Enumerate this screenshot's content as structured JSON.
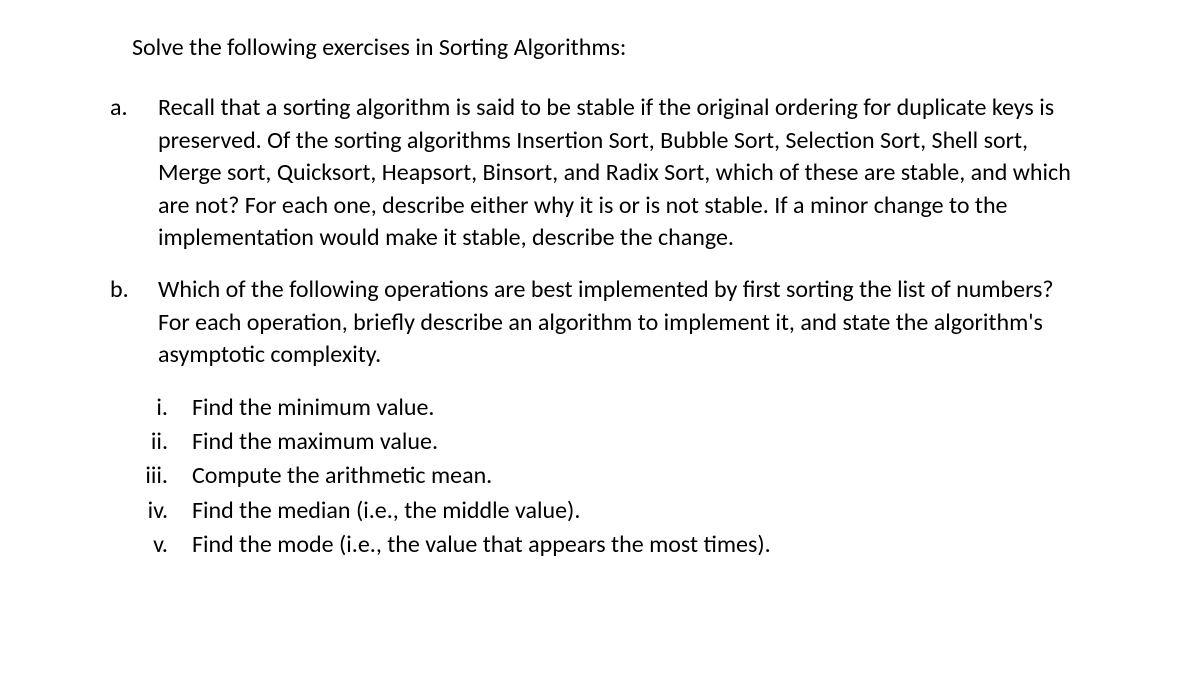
{
  "title": "Solve the following exercises in Sorting Algorithms:",
  "itemA": {
    "letter": "a.",
    "text": "Recall that a sorting algorithm is said to be stable if the original ordering for duplicate keys is preserved. Of the sorting algorithms Insertion Sort, Bubble Sort, Selection Sort, Shell sort, Merge sort, Quicksort, Heapsort, Binsort, and Radix Sort, which of these are stable, and which are not? For each one, describe either why it is or is not stable. If a minor change to the implementation would make it stable, describe the change."
  },
  "itemB": {
    "letter": "b.",
    "text": "Which of the following operations are best implemented by first sorting the list of numbers? For each operation, briefly describe an algorithm to implement it, and state the algorithm's asymptotic complexity.",
    "subitems": [
      {
        "roman": "i.",
        "text": "Find the minimum value."
      },
      {
        "roman": "ii.",
        "text": "Find the maximum value."
      },
      {
        "roman": "iii.",
        "text": "Compute the arithmetic mean."
      },
      {
        "roman": "iv.",
        "text": "Find the median (i.e., the middle value)."
      },
      {
        "roman": "v.",
        "text": "Find the mode (i.e., the value that appears the most times)."
      }
    ]
  }
}
